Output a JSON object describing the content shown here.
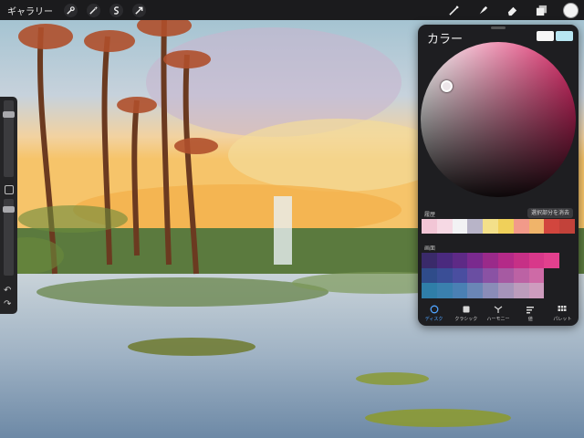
{
  "toolbar": {
    "gallery_label": "ギャラリー",
    "left_icons": [
      "wrench-icon",
      "magic-wand-icon",
      "selection-icon",
      "transform-arrow-icon"
    ],
    "right_icons": [
      "brush-icon",
      "smudge-icon",
      "eraser-icon",
      "layers-icon"
    ],
    "current_color": "#f2f2f2"
  },
  "sidebar": {
    "brush_size_level": 0.85,
    "opacity_level": 0.9
  },
  "color_panel": {
    "title": "カラー",
    "primary_swatch": "#f6f6f6",
    "secondary_swatch": "#b8e6f2",
    "history_label": "履歴",
    "clear_label": "選択部分を消去",
    "history_colors": [
      "#f2c6d6",
      "#f6d9e4",
      "#f2f2f4",
      "#b8b4c8",
      "#f3e08a",
      "#f0d05a",
      "#f29a8a",
      "#f0b46a",
      "#d2463e",
      "#c2423a"
    ],
    "palette_label": "画面",
    "palette_rows": [
      [
        "#3a2a6a",
        "#4a2a7e",
        "#5e2a86",
        "#7a2a8e",
        "#9a2a8a",
        "#b42a88",
        "#c63086",
        "#d8388a",
        "#e2408e",
        null
      ],
      [
        "#2f4c8a",
        "#3a4e96",
        "#4a4ea0",
        "#6a4ea2",
        "#8a52a4",
        "#a65aa2",
        "#bc62a4",
        "#ce6aa6",
        null,
        null
      ],
      [
        "#2f7ea8",
        "#3a80ae",
        "#4a80b4",
        "#6a86b6",
        "#8a8cb8",
        "#a694ba",
        "#bc9cbc",
        "#ce9cbe",
        null,
        null
      ]
    ],
    "tabs": [
      {
        "label": "ディスク",
        "icon": "disc-icon",
        "active": true
      },
      {
        "label": "クラシック",
        "icon": "square-icon",
        "active": false
      },
      {
        "label": "ハーモニー",
        "icon": "harmony-icon",
        "active": false
      },
      {
        "label": "値",
        "icon": "sliders-icon",
        "active": false
      },
      {
        "label": "パレット",
        "icon": "palette-grid-icon",
        "active": false
      }
    ]
  }
}
